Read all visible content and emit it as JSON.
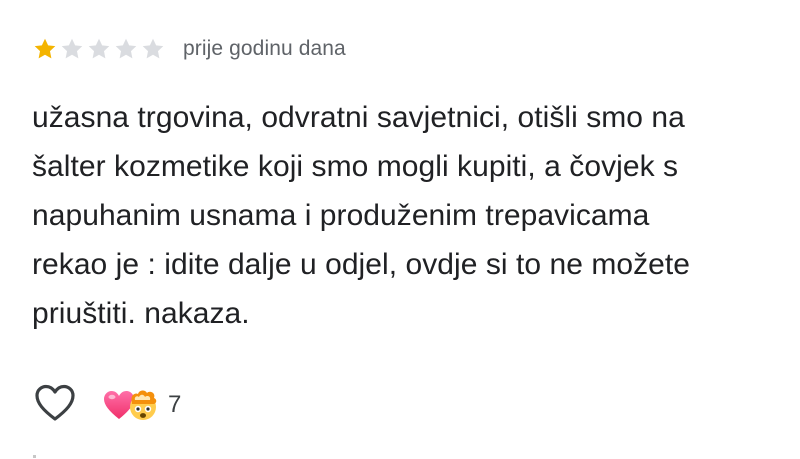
{
  "review": {
    "rating": 1,
    "max_rating": 5,
    "star_filled_color": "#f4b400",
    "star_empty_color": "#dadce0",
    "timestamp": "prije godinu dana",
    "text_lines": [
      "užasna trgovina, odvratni savjetnici, otišli smo na",
      "šalter kozmetike koji smo mogli kupiti, a čovjek s",
      "napuhanim usnama i produženim trepavicama",
      "rekao je : idite dalje u odjel, ovdje si to ne možete",
      "priuštiti. nakaza."
    ]
  },
  "actions": {
    "like_icon": "heart-outline-icon",
    "reaction_icons": [
      "pink-heart-emoji",
      "exploding-head-emoji"
    ],
    "reaction_count": "7"
  }
}
